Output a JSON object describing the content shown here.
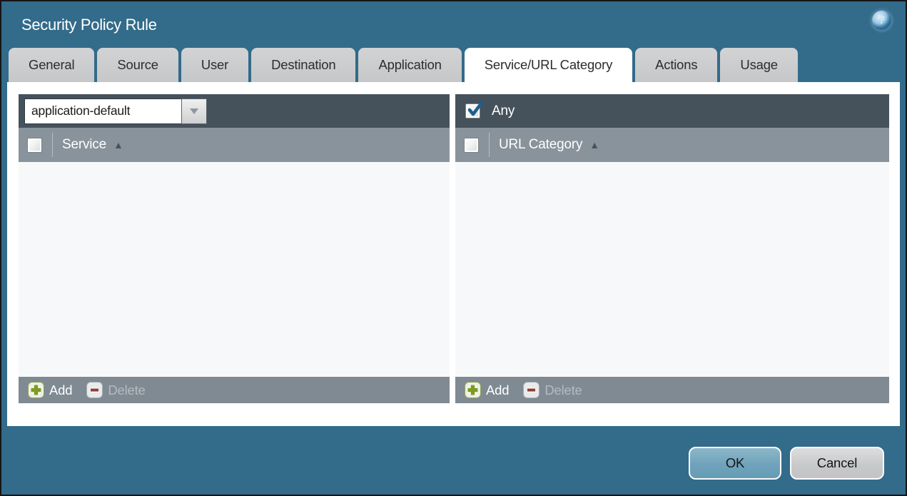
{
  "dialog": {
    "title": "Security Policy Rule"
  },
  "icons": {
    "help": "?",
    "sort_asc": "▲"
  },
  "tabs": [
    {
      "label": "General",
      "active": false
    },
    {
      "label": "Source",
      "active": false
    },
    {
      "label": "User",
      "active": false
    },
    {
      "label": "Destination",
      "active": false
    },
    {
      "label": "Application",
      "active": false
    },
    {
      "label": "Service/URL Category",
      "active": true
    },
    {
      "label": "Actions",
      "active": false
    },
    {
      "label": "Usage",
      "active": false
    }
  ],
  "service_panel": {
    "dropdown_value": "application-default",
    "column_header": "Service",
    "add_label": "Add",
    "delete_label": "Delete",
    "delete_enabled": false,
    "rows": []
  },
  "url_panel": {
    "any_label": "Any",
    "any_checked": true,
    "column_header": "URL Category",
    "add_label": "Add",
    "delete_label": "Delete",
    "delete_enabled": false,
    "rows": []
  },
  "footer": {
    "ok_label": "OK",
    "cancel_label": "Cancel"
  },
  "colors": {
    "background": "#336B8A",
    "panel_header": "#46525B",
    "column_header": "#89939B",
    "panel_footer": "#7F8A93",
    "list_background": "#F7F8F9",
    "ok_button": "#6FA3BB",
    "cancel_button": "#C7C8CA",
    "add_green": "#7D9B21",
    "delete_red": "#8D4034",
    "check_blue": "#1D5F8D"
  }
}
